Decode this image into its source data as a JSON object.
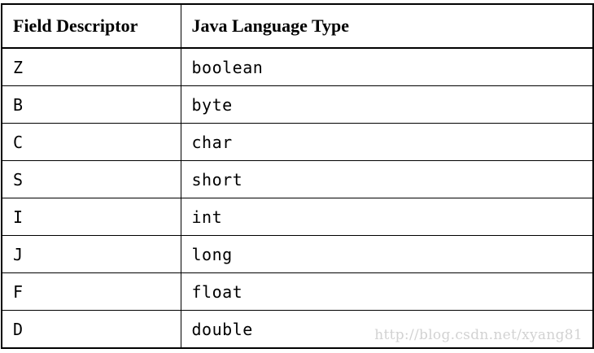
{
  "table": {
    "headers": [
      "Field Descriptor",
      "Java Language Type"
    ],
    "rows": [
      [
        "Z",
        "boolean"
      ],
      [
        "B",
        "byte"
      ],
      [
        "C",
        "char"
      ],
      [
        "S",
        "short"
      ],
      [
        "I",
        "int"
      ],
      [
        "J",
        "long"
      ],
      [
        "F",
        "float"
      ],
      [
        "D",
        "double"
      ]
    ]
  },
  "watermark": "http://blog.csdn.net/xyang81"
}
